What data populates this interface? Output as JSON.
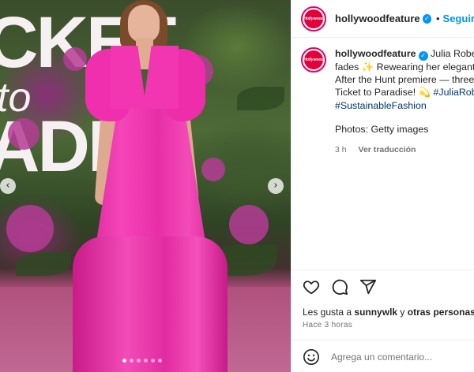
{
  "photo": {
    "backdrop_lines": [
      "CKET",
      "to",
      "ADIS"
    ],
    "carousel_dots": 6,
    "active_dot": 0
  },
  "post": {
    "avatar_text": "Hollywood",
    "username": "hollywoodfeature",
    "separator": "•",
    "follow_label": "Seguir",
    "caption": {
      "username": "hollywoodfeature",
      "line1": "Julia Roberts",
      "line2": "fades ✨ Rewearing her elegant G",
      "line3": "After the Hunt premiere — three y",
      "line4": "Ticket to Paradise! 💫",
      "hashtag1": "#JuliaRober",
      "hashtag2": "#SustainableFashion",
      "credit": "Photos: Getty images"
    },
    "age": "3 h",
    "translate_label": "Ver traducción"
  },
  "engagement": {
    "likes_prefix": "Les gusta a",
    "likes_user": "sunnywlk",
    "likes_joiner": "y",
    "likes_others": "otras personas",
    "time": "Hace 3 horas",
    "comment_placeholder": "Agrega un comentario..."
  },
  "colors": {
    "accent_blue": "#0095f6",
    "hashtag_blue": "#00376b",
    "dress_pink": "#f236b2"
  }
}
